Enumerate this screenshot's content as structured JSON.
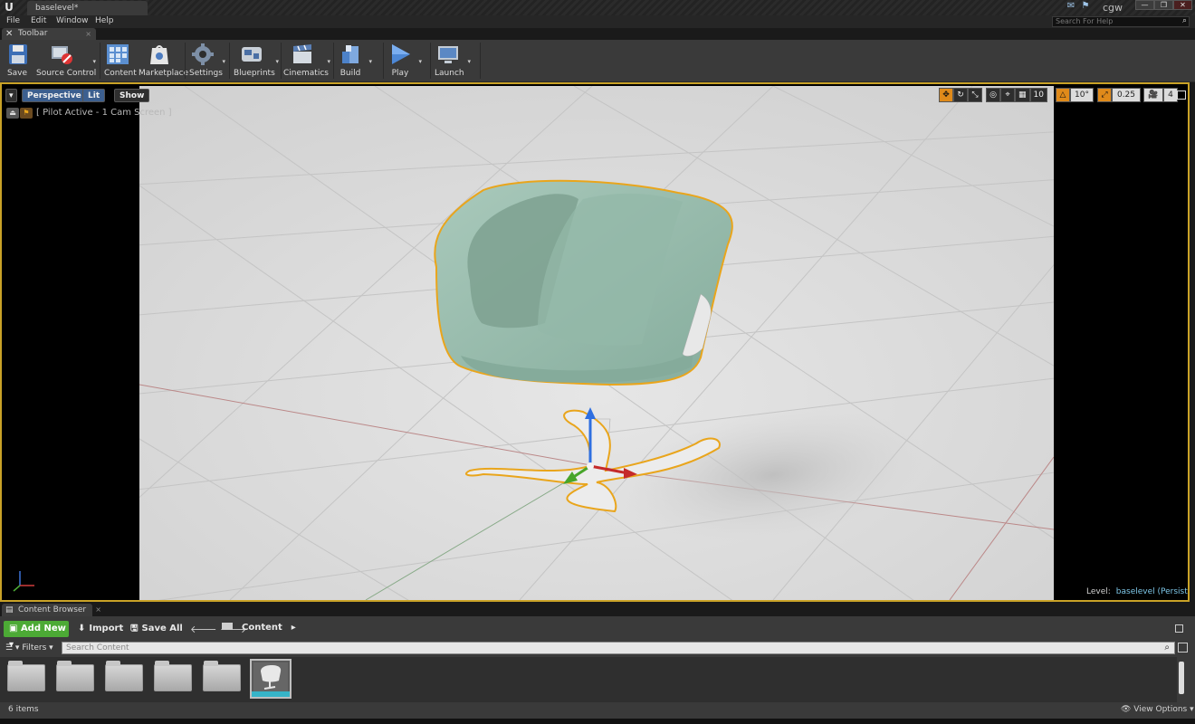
{
  "window": {
    "doc_tab": "baselevel*",
    "user": "cgw",
    "help_search_placeholder": "Search For Help"
  },
  "menu": [
    "File",
    "Edit",
    "Window",
    "Help"
  ],
  "toolbar": {
    "tab_label": "Toolbar",
    "buttons": [
      {
        "label": "Save",
        "icon": "save-icon"
      },
      {
        "label": "Source Control",
        "icon": "source-control-icon"
      },
      {
        "label": "Content",
        "icon": "content-icon"
      },
      {
        "label": "Marketplace",
        "icon": "marketplace-icon"
      },
      {
        "label": "Settings",
        "icon": "settings-icon"
      },
      {
        "label": "Blueprints",
        "icon": "blueprints-icon"
      },
      {
        "label": "Cinematics",
        "icon": "cinematics-icon"
      },
      {
        "label": "Build",
        "icon": "build-icon"
      },
      {
        "label": "Play",
        "icon": "play-icon"
      },
      {
        "label": "Launch",
        "icon": "launch-icon"
      }
    ]
  },
  "viewport": {
    "perspective_label": "Perspective",
    "lit_label": "Lit",
    "show_label": "Show",
    "pilot_text": "[ Pilot Active - 1 Cam Screen ]",
    "rotation_snap": "10°",
    "scale_snap": "0.25",
    "grid_snap": "10",
    "camera_speed": "4",
    "level_label": "Level:",
    "level_value": "baselevel (Persistent)",
    "selection_color": "#e9a51c",
    "chair_color": "#9fc2b3"
  },
  "content_browser": {
    "tab_label": "Content Browser",
    "add_new": "Add New",
    "import": "Import",
    "save_all": "Save All",
    "path": "Content",
    "filters": "Filters",
    "search_placeholder": "Search Content",
    "item_count": "6 items",
    "view_options": "View Options"
  }
}
